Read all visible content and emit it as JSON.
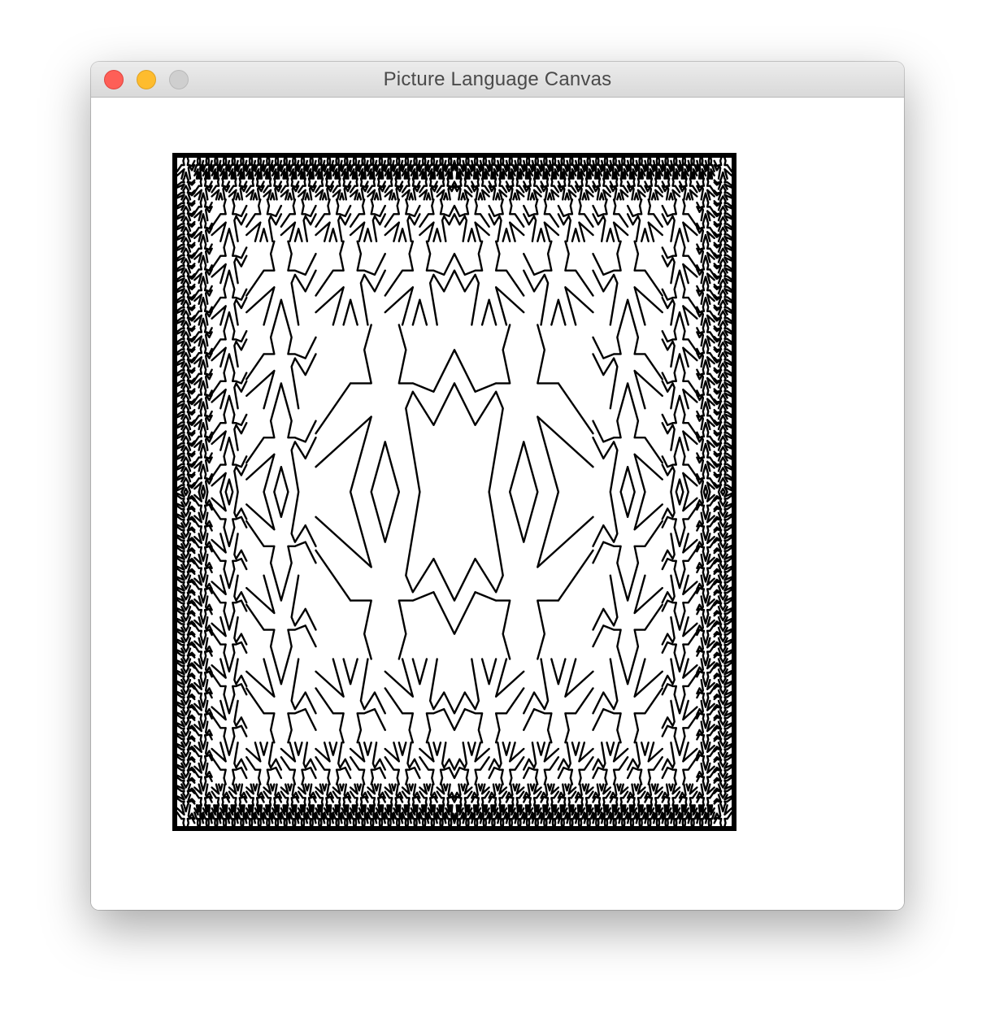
{
  "window": {
    "title": "Picture Language Canvas",
    "controls": [
      "close",
      "minimize",
      "zoom"
    ]
  },
  "colors": {
    "close": "#fe5f57",
    "minimize": "#febc2e",
    "zoom": "#cfcfcf",
    "ink": "#000000",
    "paper": "#ffffff"
  },
  "canvas": {
    "figure": "recursive-square-limit-pattern",
    "motif": "stick-figure"
  }
}
